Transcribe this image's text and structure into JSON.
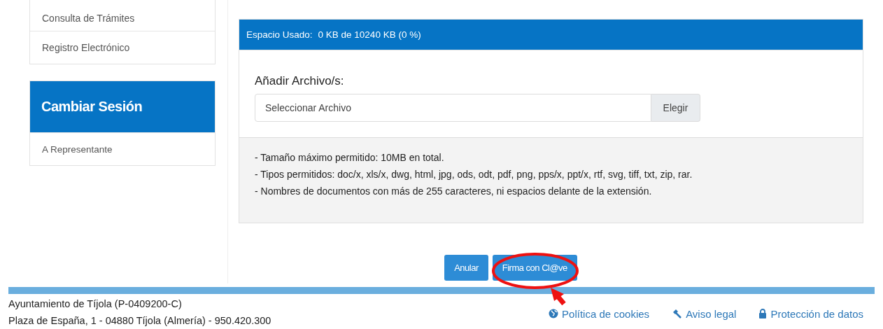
{
  "sidebar": {
    "menu": [
      {
        "label": "Consulta de Trámites"
      },
      {
        "label": "Registro Electrónico"
      }
    ],
    "session": {
      "title": "Cambiar Sesión",
      "items": [
        {
          "label": "A Representante"
        }
      ]
    }
  },
  "upload": {
    "header_label": "Espacio Usado:",
    "header_value": "0 KB de 10240 KB (0 %)",
    "field_label": "Añadir Archivo/s:",
    "placeholder": "Seleccionar Archivo",
    "browse": "Elegir",
    "notes": [
      "- Tamaño máximo permitido: 10MB en total.",
      "- Tipos permitidos: doc/x, xls/x, dwg, html, jpg, ods, odt, pdf, png, pps/x, ppt/x, rtf, svg, tiff, txt, zip, rar.",
      "- Nombres de documentos con más de 255 caracteres, ni espacios delante de la extensión."
    ]
  },
  "buttons": [
    {
      "label": "Anular"
    },
    {
      "label": "Firma con Cl@ve"
    }
  ],
  "footer": {
    "lines": [
      "Ayuntamiento de Tíjola (P-0409200-C)",
      "Plaza de España, 1 - 04880 Tíjola (Almería) - 950.420.300"
    ],
    "links": [
      {
        "kind": "globe",
        "label": "Política de cookies"
      },
      {
        "kind": "gavel",
        "label": "Aviso legal"
      },
      {
        "kind": "lock",
        "label": "Protección de datos"
      }
    ]
  }
}
